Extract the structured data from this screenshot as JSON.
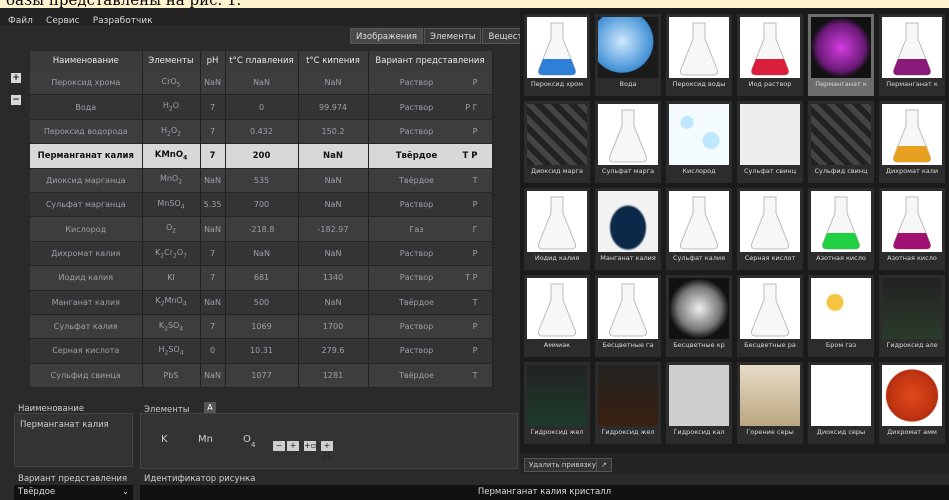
{
  "doc_fragment": "базы представлены на рис. 1.",
  "menu": [
    "Файл",
    "Сервис",
    "Разработчик"
  ],
  "tabs": [
    "Изображения",
    "Элементы",
    "Вещест"
  ],
  "columns": [
    "Наименование",
    "Элементы",
    "pH",
    "t°С плавления",
    "t°С кипения",
    "Вариант представления"
  ],
  "rows": [
    {
      "name": "Пероксид хрома",
      "elements": "CrO5",
      "ph": "NaN",
      "melt": "NaN",
      "boil": "NaN",
      "repr": "Раствор",
      "vis": "Р"
    },
    {
      "name": "Вода",
      "elements": "H2O",
      "ph": "7",
      "melt": "0",
      "boil": "99.974",
      "repr": "Раствор",
      "vis": "Р Г"
    },
    {
      "name": "Пероксид водорода",
      "elements": "H2O2",
      "ph": "7",
      "melt": "0.432",
      "boil": "150.2",
      "repr": "Раствор",
      "vis": "Р"
    },
    {
      "name": "Перманганат калия",
      "elements": "KMnO4",
      "ph": "7",
      "melt": "200",
      "boil": "NaN",
      "repr": "Твёрдое",
      "vis": "Т Р"
    },
    {
      "name": "Диоксид марганца",
      "elements": "MnO2",
      "ph": "NaN",
      "melt": "535",
      "boil": "NaN",
      "repr": "Твёрдое",
      "vis": "Т"
    },
    {
      "name": "Сульфат марганца",
      "elements": "MnSO4",
      "ph": "5.35",
      "melt": "700",
      "boil": "NaN",
      "repr": "Раствор",
      "vis": "Р"
    },
    {
      "name": "Кислород",
      "elements": "O2",
      "ph": "NaN",
      "melt": "-218.8",
      "boil": "-182.97",
      "repr": "Газ",
      "vis": "Г"
    },
    {
      "name": "Дихромат калия",
      "elements": "K2Cr2O7",
      "ph": "7",
      "melt": "NaN",
      "boil": "NaN",
      "repr": "Раствор",
      "vis": "Р"
    },
    {
      "name": "Иодид калия",
      "elements": "KI",
      "ph": "7",
      "melt": "681",
      "boil": "1340",
      "repr": "Раствор",
      "vis": "Т Р"
    },
    {
      "name": "Манганат калия",
      "elements": "K2MnO4",
      "ph": "NaN",
      "melt": "500",
      "boil": "NaN",
      "repr": "Твёрдое",
      "vis": "Т"
    },
    {
      "name": "Сульфат калия",
      "elements": "K2SO4",
      "ph": "7",
      "melt": "1069",
      "boil": "1700",
      "repr": "Раствор",
      "vis": "Р"
    },
    {
      "name": "Серная кислота",
      "elements": "H2SO4",
      "ph": "0",
      "melt": "10.31",
      "boil": "279.6",
      "repr": "Раствор",
      "vis": "Р"
    },
    {
      "name": "Сульфид свинца",
      "elements": "PbS",
      "ph": "NaN",
      "melt": "1077",
      "boil": "1281",
      "repr": "Твёрдое",
      "vis": "Т"
    }
  ],
  "selected_row": 3,
  "bottom": {
    "name_label": "Наименование",
    "name_value": "Перманганат калия",
    "elements_label": "Элементы",
    "elements_tag": "A",
    "elements_tokens": [
      "K",
      "Mn",
      "O",
      "4"
    ],
    "repr_label": "Вариант представления",
    "repr_value": "Твёрдое",
    "image_id_label": "Идентификатор рисунка",
    "image_id_value": "Перманганат калия кристалл"
  },
  "gallery": [
    "Пероксид хром",
    "Вода",
    "Пероксид воды",
    "Иод раствор",
    "Перманганат к",
    "Перманганат к",
    "Диоксид марга",
    "Сульфат марга",
    "Кислород",
    "Сульфат свинц",
    "Сульфид свинц",
    "Дихромат кали",
    "Иодид калия",
    "Манганат калия",
    "Сульфат калия",
    "Серная кислот",
    "Азотная кисло",
    "Азотная кисло",
    "Аммиак",
    "Бесцветные га",
    "Бесцветные кр",
    "Бесцветные ра",
    "Бром газ",
    "Гидроксид але",
    "Гидроксид жел",
    "Гидроксид жел",
    "Гидроксид кал",
    "Горение серы",
    "Диоксид серы",
    "Дихромат амм"
  ],
  "selected_gallery": 4,
  "gallery_buttons": [
    "Удалить привязку",
    "↗"
  ],
  "colors": {
    "accent": "#d8d8d8",
    "bg": "#2a2a2a",
    "cell_bg": "#2c2c2c"
  }
}
